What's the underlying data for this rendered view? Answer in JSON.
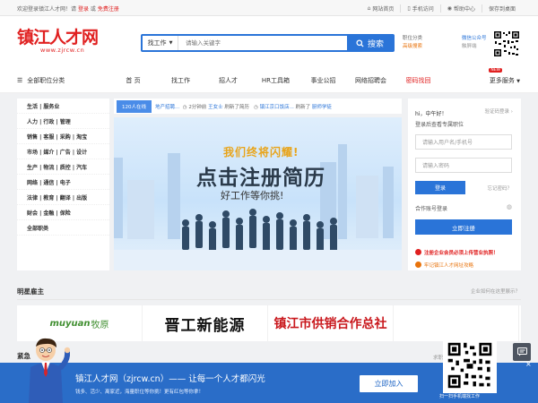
{
  "topbar": {
    "welcome": "欢迎登录镇江人才网！请",
    "login": "登录",
    "or": "或",
    "register": "免费注册",
    "links": [
      "网站首页",
      "手机访问",
      "帮助中心",
      "保存到桌面"
    ]
  },
  "header": {
    "logo_text": "镇江人才网",
    "logo_url": "www.zjrcw.cn",
    "search_type": "找工作",
    "search_placeholder": "请输入关键字",
    "search_button": "搜索",
    "links": [
      "职位分类",
      "高级搜索"
    ],
    "wx_label": "微信公众号",
    "wx_sub": "触屏端"
  },
  "nav": {
    "all_categories": "全部职位分类",
    "items": [
      "首 页",
      "找工作",
      "招人才",
      "HR工具箱",
      "事业公招",
      "网络招聘会",
      "密码找回"
    ],
    "more": "更多服务",
    "new_badge": "NEW"
  },
  "categories": [
    "生活 | 服务业",
    "人力 | 行政 | 管理",
    "销售 | 客服 | 采购 | 淘宝",
    "市场 | 媒介 | 广告 | 设计",
    "生产 | 物流 | 质控 | 汽车",
    "网络 | 通信 | 电子",
    "法律 | 教育 | 翻译 | 出版",
    "财会 | 金融 | 保险",
    "全部职类"
  ],
  "ticker": {
    "online": "120人在线",
    "segments": [
      "地产招聘...",
      "2分钟前",
      "王女士",
      "刷新了简历",
      "镇江京口饭店...",
      "刷新了",
      "厨师学徒"
    ]
  },
  "banner": {
    "line1": "我们终将闪耀!",
    "line2": "点击注册简历",
    "line3": "好工作等你挑!"
  },
  "login": {
    "greeting": "hi，中午好！",
    "sub": "登录后查看专属职位",
    "verify_login": "验证码登录",
    "username_placeholder": "请输入用户名/手机号",
    "password_placeholder": "请输入密码",
    "login_button": "登录",
    "forgot": "忘记密码？",
    "partner": "合作账号登录",
    "register_button": "立即注册",
    "note1": "注册企业会员必须上传营业执照！",
    "note2": "牢记镇江人才网址攻略"
  },
  "employers": {
    "title": "明星雇主",
    "link": "企业如何在这里展示？",
    "items": [
      {
        "a": "muyuan",
        "b": "牧原"
      },
      {
        "a": "晋工新能源"
      },
      {
        "a": "镇江市供销合作总社"
      }
    ]
  },
  "section2": {
    "title": "紧急",
    "right": "求职"
  },
  "overlay": {
    "title": "镇江人才网（zjrcw.cn）—— 让每一个人才都闪光",
    "sub": "钱多、活少、离家近，海量职位等你挑！更有红包等你拿！",
    "join": "立即加入",
    "qr_caption": "扫一扫手机端找工作"
  },
  "colors": {
    "brand": "#e02020",
    "accent": "#2a74d8",
    "overlay": "#1b63c4"
  }
}
